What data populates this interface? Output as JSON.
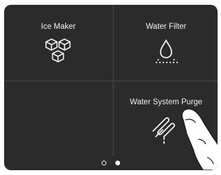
{
  "tiles": [
    {
      "label": "Ice Maker",
      "icon": "ice-cubes-icon"
    },
    {
      "label": "Water Filter",
      "icon": "water-drop-icon"
    },
    {
      "label": "",
      "icon": ""
    },
    {
      "label": "Water System Purge",
      "icon": "purge-pipe-icon"
    }
  ],
  "pager": {
    "page_count": 2,
    "current_page": 2
  },
  "colors": {
    "background": "#2b2b2b",
    "divider": "#3d3d3d",
    "text": "#f2f2f2"
  }
}
